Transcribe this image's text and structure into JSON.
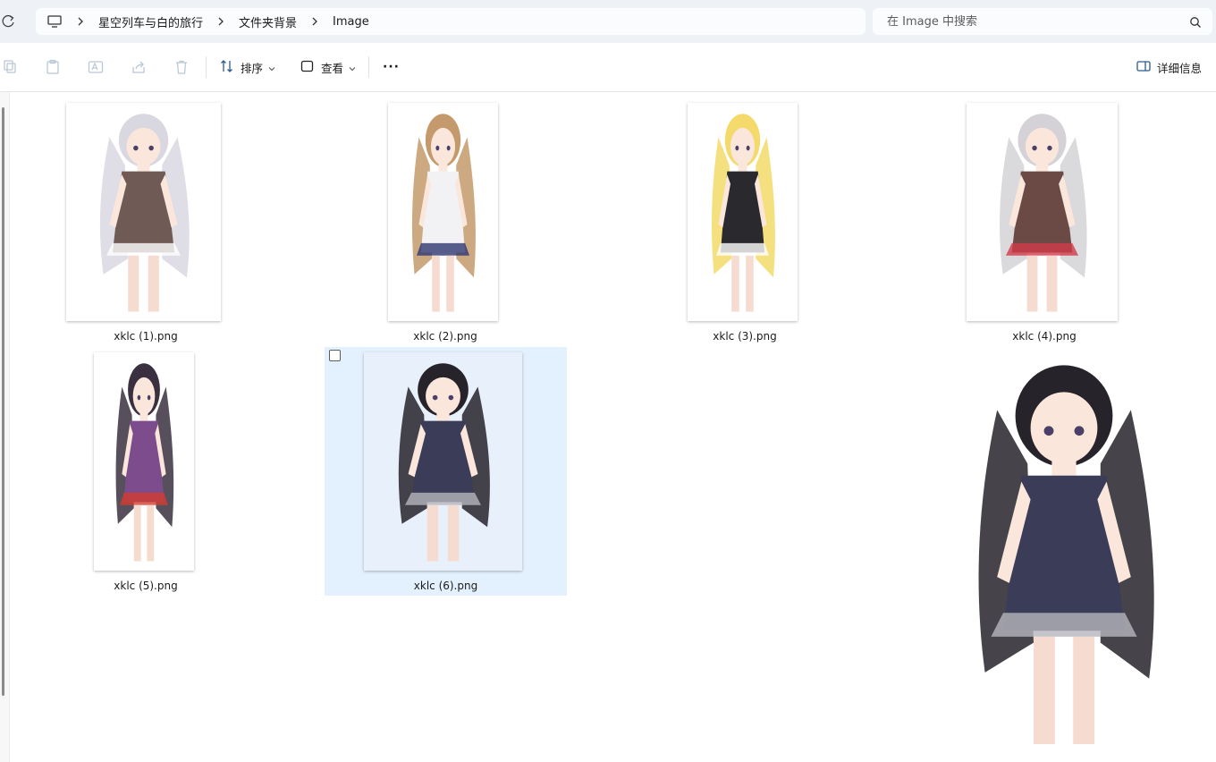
{
  "breadcrumb": {
    "items": [
      "星空列车与白的旅行",
      "文件夹背景",
      "Image"
    ]
  },
  "search": {
    "placeholder": "在 Image 中搜索"
  },
  "toolbar": {
    "sort_label": "排序",
    "view_label": "查看",
    "more_label": "···",
    "details_label": "详细信息"
  },
  "files": [
    {
      "name": "xklc (1).png",
      "hair": "#d9d7e0",
      "outfit": "#6f5a55",
      "accent": "#ffffff"
    },
    {
      "name": "xklc (2).png",
      "hair": "#c49a6c",
      "outfit": "#f2f2f4",
      "accent": "#2e3770"
    },
    {
      "name": "xklc (3).png",
      "hair": "#f3da6a",
      "outfit": "#2a2a2e",
      "accent": "#ffffff"
    },
    {
      "name": "xklc (4).png",
      "hair": "#d4d2d6",
      "outfit": "#6b4a45",
      "accent": "#d23a4a"
    },
    {
      "name": "xklc (5).png",
      "hair": "#3a3040",
      "outfit": "#7d4c8c",
      "accent": "#d33c2e"
    },
    {
      "name": "xklc (6).png",
      "hair": "#26232a",
      "outfit": "#3a3c58",
      "accent": "#b7b5bd"
    }
  ],
  "colors": {
    "selection_bg": "#e3f0fd",
    "address_bar_bg": "#eef2f7"
  }
}
